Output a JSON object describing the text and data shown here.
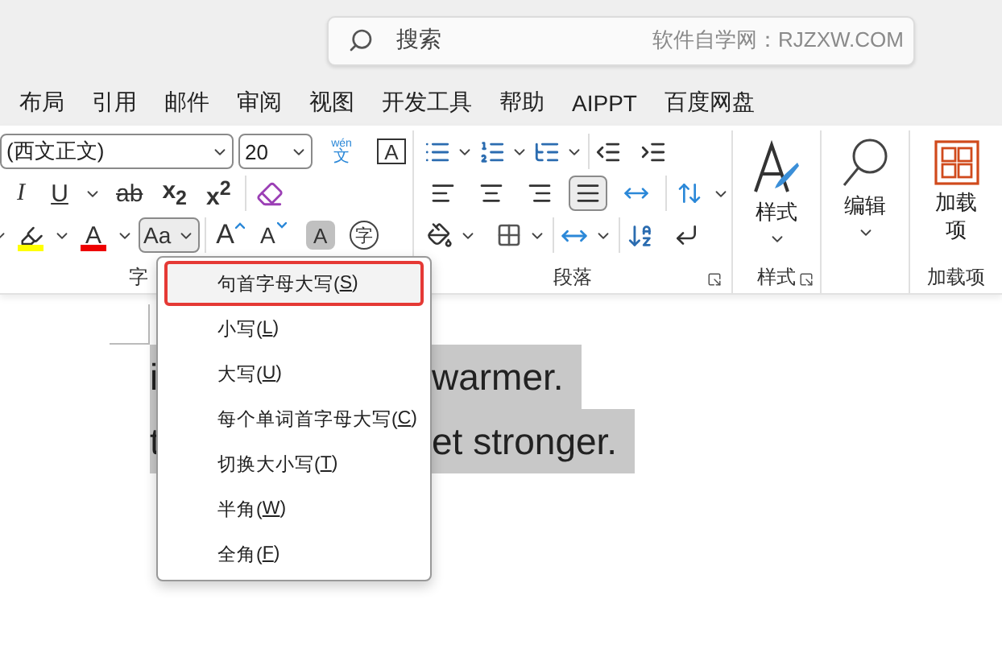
{
  "search": {
    "placeholder": "搜索",
    "hint": "软件自学网：RJZXW.COM"
  },
  "menu_tabs": [
    "布局",
    "引用",
    "邮件",
    "审阅",
    "视图",
    "开发工具",
    "帮助",
    "AIPPT",
    "百度网盘"
  ],
  "font_group": {
    "label": "字",
    "font_name": "(西文正文)",
    "font_size": "20",
    "row1": [
      {
        "kind": "phonetic",
        "top": "wén",
        "glyph": "文"
      },
      {
        "kind": "boxed",
        "glyph": "A"
      }
    ],
    "row2": [
      {
        "kind": "italic",
        "glyph": "I"
      },
      {
        "kind": "underline",
        "glyph": "U"
      },
      {
        "kind": "strike",
        "glyph": "ab"
      },
      {
        "kind": "script",
        "glyph": "x$_{2}$"
      },
      {
        "kind": "script",
        "glyph": "x$^{2}$"
      },
      {
        "kind": "clear"
      }
    ],
    "row3": [
      {
        "kind": "highlight",
        "expanded": false
      },
      {
        "kind": "fontcolor",
        "glyph": "A",
        "expanded": false
      },
      {
        "kind": "case",
        "glyph": "Aa",
        "expanded": true
      },
      {
        "kind": "grow",
        "glyph": "A",
        "expanded": false
      },
      {
        "kind": "shrink",
        "glyph": "A",
        "expanded": false
      },
      {
        "kind": "shade",
        "glyph": "A",
        "expanded": false
      },
      {
        "kind": "enclose",
        "glyph": "字",
        "expanded": false
      }
    ]
  },
  "paragraph_group": {
    "label": "段落",
    "alignment": [
      {
        "kind": "left",
        "selected": false
      },
      {
        "kind": "center",
        "selected": false
      },
      {
        "kind": "right",
        "selected": false
      },
      {
        "kind": "justify",
        "selected": true
      },
      {
        "kind": "distributed",
        "selected": false
      }
    ]
  },
  "styles_group": {
    "button": "样式",
    "label": "样式"
  },
  "editing_group": {
    "button": "编辑"
  },
  "addins_group": {
    "button": "加载项",
    "label": "加载项"
  },
  "document_lines": [
    {
      "left": "i",
      "right": "warmer."
    },
    {
      "left": "t",
      "right": "et stronger."
    }
  ],
  "case_menu": [
    {
      "prefix": "句首字母大写(",
      "key": "S",
      "suffix": ")",
      "selected": true
    },
    {
      "prefix": "小写(",
      "key": "L",
      "suffix": ")",
      "selected": false
    },
    {
      "prefix": "大写(",
      "key": "U",
      "suffix": ")",
      "selected": false
    },
    {
      "prefix": "每个单词首字母大写(",
      "key": "C",
      "suffix": ")",
      "selected": false
    },
    {
      "prefix": "切换大小写(",
      "key": "T",
      "suffix": ")",
      "selected": false
    },
    {
      "prefix": "半角(",
      "key": "W",
      "suffix": ")",
      "selected": false
    },
    {
      "prefix": "全角(",
      "key": "F",
      "suffix": ")",
      "selected": false
    }
  ]
}
